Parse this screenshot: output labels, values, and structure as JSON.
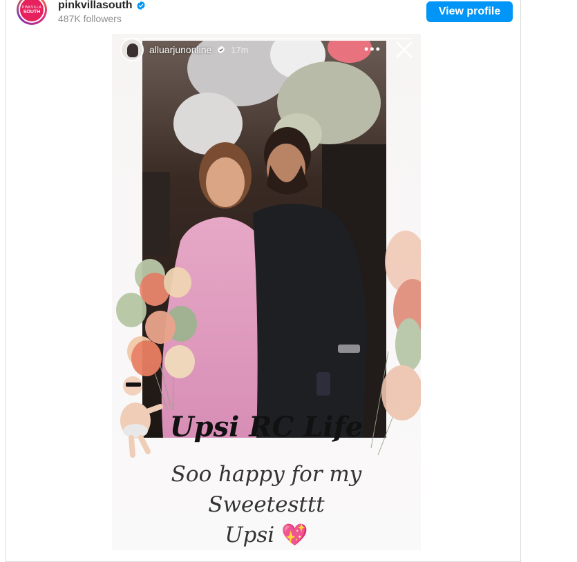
{
  "post": {
    "username": "pinkvillasouth",
    "followers": "487K followers",
    "view_profile_label": "View profile",
    "avatar_text_top": "PINKVILLA",
    "avatar_text_bottom": "SOUTH"
  },
  "story": {
    "username": "alluarjunonline",
    "time": "17m",
    "menu": "•••",
    "caption_title": "Upsi RC Life",
    "caption_line1": "Soo happy for my",
    "caption_line2": "Sweetesttt",
    "caption_line3": "Upsi",
    "caption_emoji": "💖"
  },
  "colors": {
    "accent": "#0095f6",
    "brand": "#e6215e",
    "verified": "#0095f6"
  }
}
